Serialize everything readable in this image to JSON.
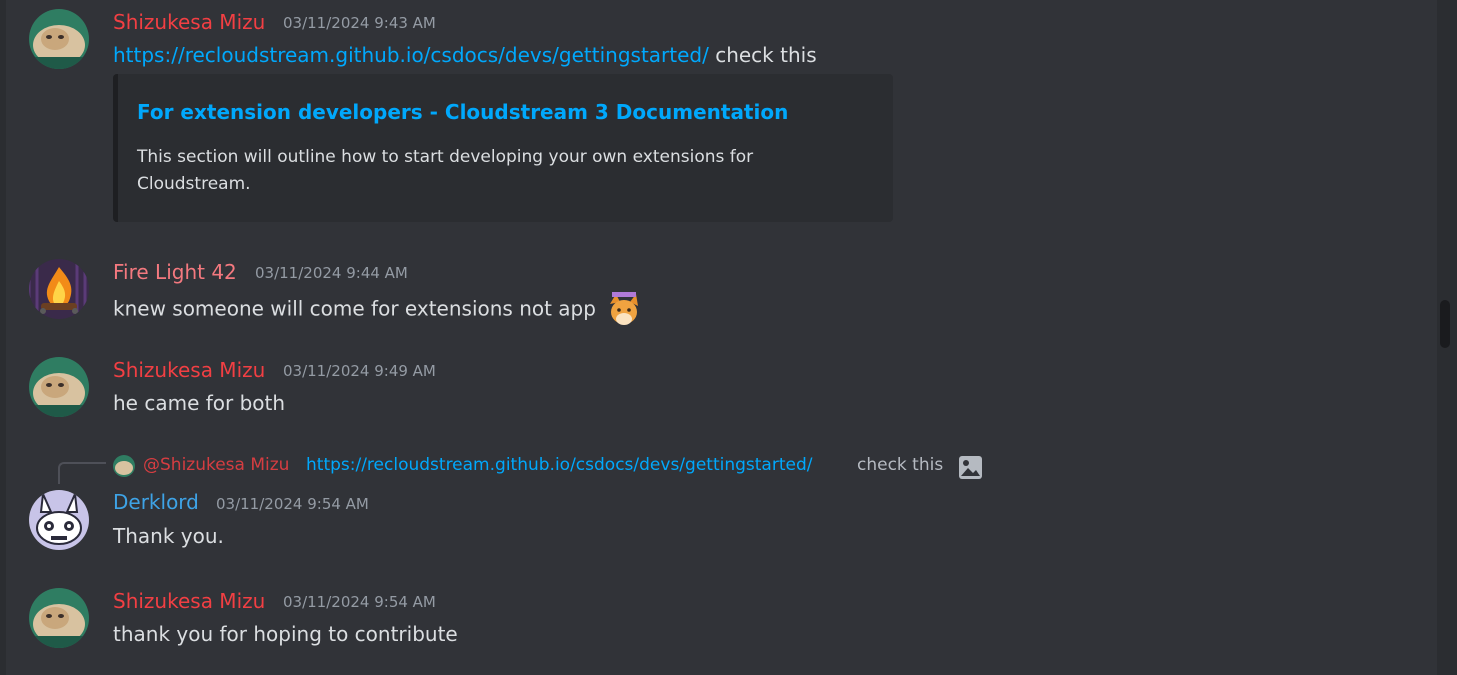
{
  "colors": {
    "background": "#313338",
    "name_shizukesa": "#f23f43",
    "name_firelight": "#f4797f",
    "name_derklord": "#3ea3e6",
    "link": "#00a8fc",
    "timestamp": "#949ba4"
  },
  "messages": [
    {
      "author": "Shizukesa Mizu",
      "timestamp": "03/11/2024 9:43 AM",
      "link": "https://recloudstream.github.io/csdocs/devs/gettingstarted/",
      "text": " check this",
      "embed": {
        "title": "For extension developers - Cloudstream 3 Documentation",
        "description": "This section will outline how to start developing your own extensions for Cloudstream."
      },
      "avatar_icon": "cat-avatar"
    },
    {
      "author": "Fire Light 42",
      "timestamp": "03/11/2024 9:44 AM",
      "text": "knew someone will come for extensions not app",
      "emoji_icon": "fox-emoji",
      "avatar_icon": "campfire-avatar"
    },
    {
      "author": "Shizukesa Mizu",
      "timestamp": "03/11/2024 9:49 AM",
      "text": "he came for both",
      "avatar_icon": "cat-avatar"
    },
    {
      "reply": {
        "mention": "@Shizukesa Mizu",
        "link": "https://recloudstream.github.io/csdocs/devs/gettingstarted/",
        "text": "check this",
        "icon": "image-icon"
      },
      "author": "Derklord",
      "timestamp": "03/11/2024 9:54 AM",
      "text": "Thank you.",
      "avatar_icon": "bunny-avatar"
    },
    {
      "author": "Shizukesa Mizu",
      "timestamp": "03/11/2024 9:54 AM",
      "text": "thank you for hoping to contribute",
      "avatar_icon": "cat-avatar"
    }
  ]
}
